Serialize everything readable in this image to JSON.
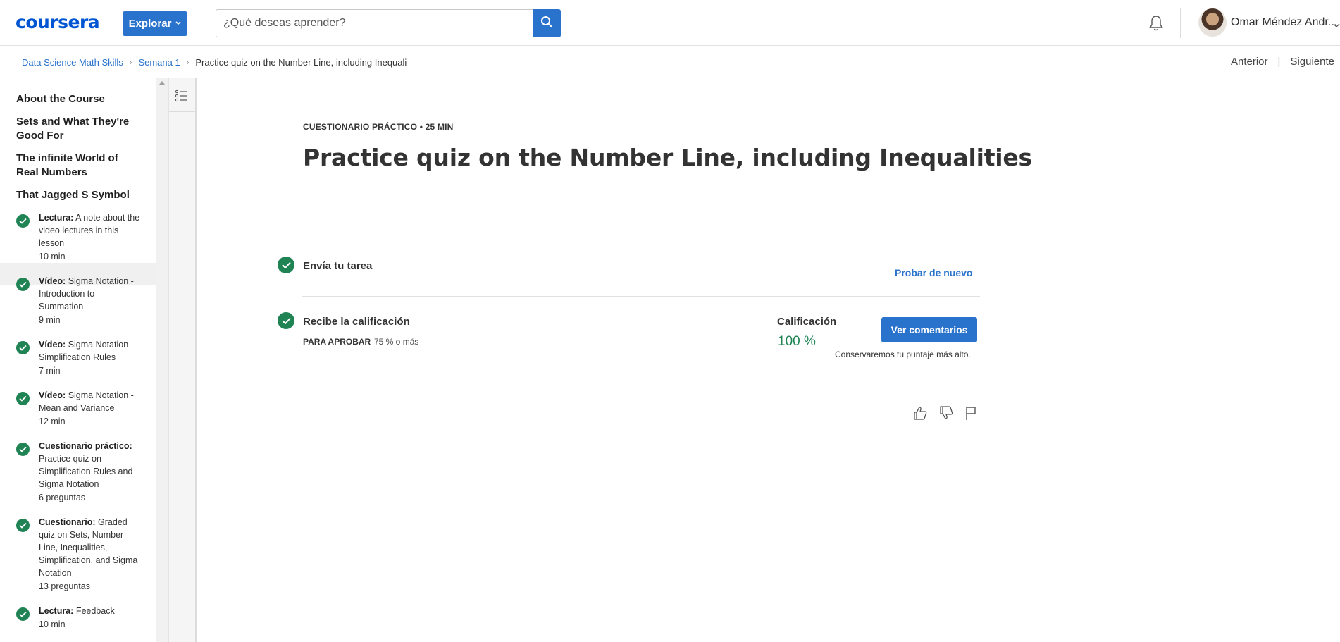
{
  "header": {
    "logo": "coursera",
    "explore_label": "Explorar",
    "search_placeholder": "¿Qué deseas aprender?",
    "user_name": "Omar Méndez Andr..."
  },
  "breadcrumb": {
    "items": [
      "Data Science Math Skills",
      "Semana 1"
    ],
    "current": "Practice quiz on the Number Line, including Inequalities"
  },
  "pager": {
    "prev": "Anterior",
    "separator": "|",
    "next": "Siguiente"
  },
  "sidebar": {
    "lessons": [
      "About the Course",
      "Sets and What They're Good For",
      "The infinite World of Real Numbers",
      "That Jagged S Symbol"
    ],
    "items": [
      {
        "type": "Lectura:",
        "name": "A note about the video lectures in this lesson",
        "duration": "10 min"
      },
      {
        "type": "Vídeo:",
        "name": "Sigma Notation - Introduction to Summation",
        "duration": "9 min"
      },
      {
        "type": "Vídeo:",
        "name": "Sigma Notation - Simplification Rules",
        "duration": "7 min"
      },
      {
        "type": "Vídeo:",
        "name": "Sigma Notation - Mean and Variance",
        "duration": "12 min"
      },
      {
        "type": "Cuestionario práctico:",
        "name": "Practice quiz on Simplification Rules and Sigma Notation",
        "duration": "6 preguntas"
      },
      {
        "type": "Cuestionario:",
        "name": "Graded quiz on Sets, Number Line, Inequalities, Simplification, and Sigma Notation",
        "duration": "13 preguntas"
      },
      {
        "type": "Lectura:",
        "name": "Feedback",
        "duration": "10 min"
      }
    ]
  },
  "main": {
    "eyebrow": "CUESTIONARIO PRÁCTICO • 25 MIN",
    "title": "Practice quiz on the Number Line, including Inequalities",
    "submit_step": "Envía tu tarea",
    "retry_label": "Probar de nuevo",
    "grade_step": "Recibe la calificación",
    "pass_label": "PARA APROBAR",
    "pass_value": "75 % o más",
    "grade_label": "Calificación",
    "grade_value": "100 %",
    "feedback_button": "Ver comentarios",
    "keep_note": "Conservaremos tu puntaje más alto."
  },
  "colors": {
    "brand": "#0056d2",
    "primary": "#2a73cc",
    "success": "#1f8354"
  },
  "icons": [
    "search-icon",
    "bell-icon",
    "chevron-down-icon",
    "list-icon",
    "check-icon",
    "thumbs-up-icon",
    "thumbs-down-icon",
    "flag-icon"
  ]
}
